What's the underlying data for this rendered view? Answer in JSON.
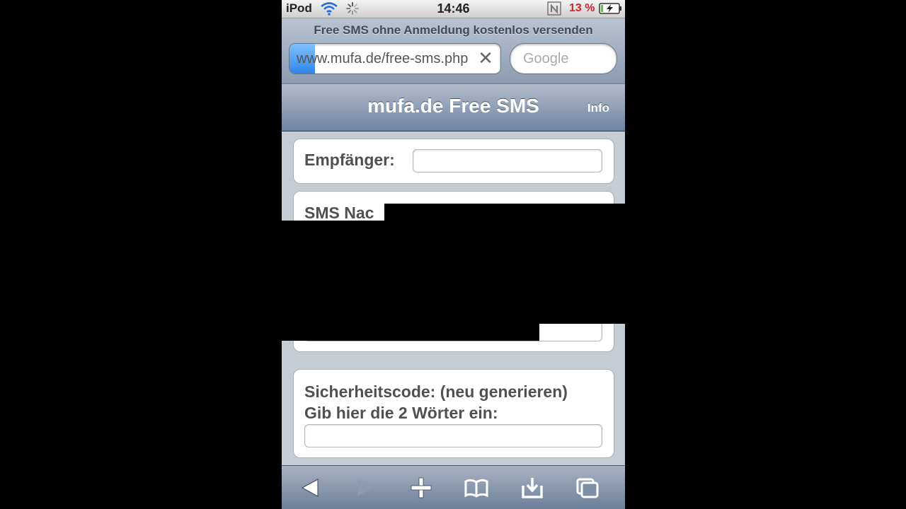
{
  "status_bar": {
    "carrier": "iPod",
    "time": "14:46",
    "battery_percent": "13 %",
    "battery_level": 0.13,
    "colors": {
      "battery_text": "#d2202a",
      "battery_fill": "#4cd137"
    }
  },
  "browser": {
    "page_title": "Free SMS ohne Anmeldung kostenlos versenden",
    "url": "www.mufa.de/free-sms.php",
    "load_progress": 0.12,
    "search_placeholder": "Google"
  },
  "navbar": {
    "title": "mufa.de Free SMS",
    "info_label": "Info"
  },
  "form": {
    "recipient_label": "Empfänger:",
    "recipient_value": "",
    "message_label": "SMS Nac",
    "message_value": "",
    "captcha_label": "Sicherheitscode: (neu generieren)",
    "captcha_instruction": "Gib hier die 2 Wörter ein:",
    "captcha_value": ""
  },
  "toolbar": {
    "items": [
      "back-icon",
      "forward-icon",
      "add-icon",
      "bookmarks-icon",
      "download-icon",
      "pages-icon"
    ]
  }
}
